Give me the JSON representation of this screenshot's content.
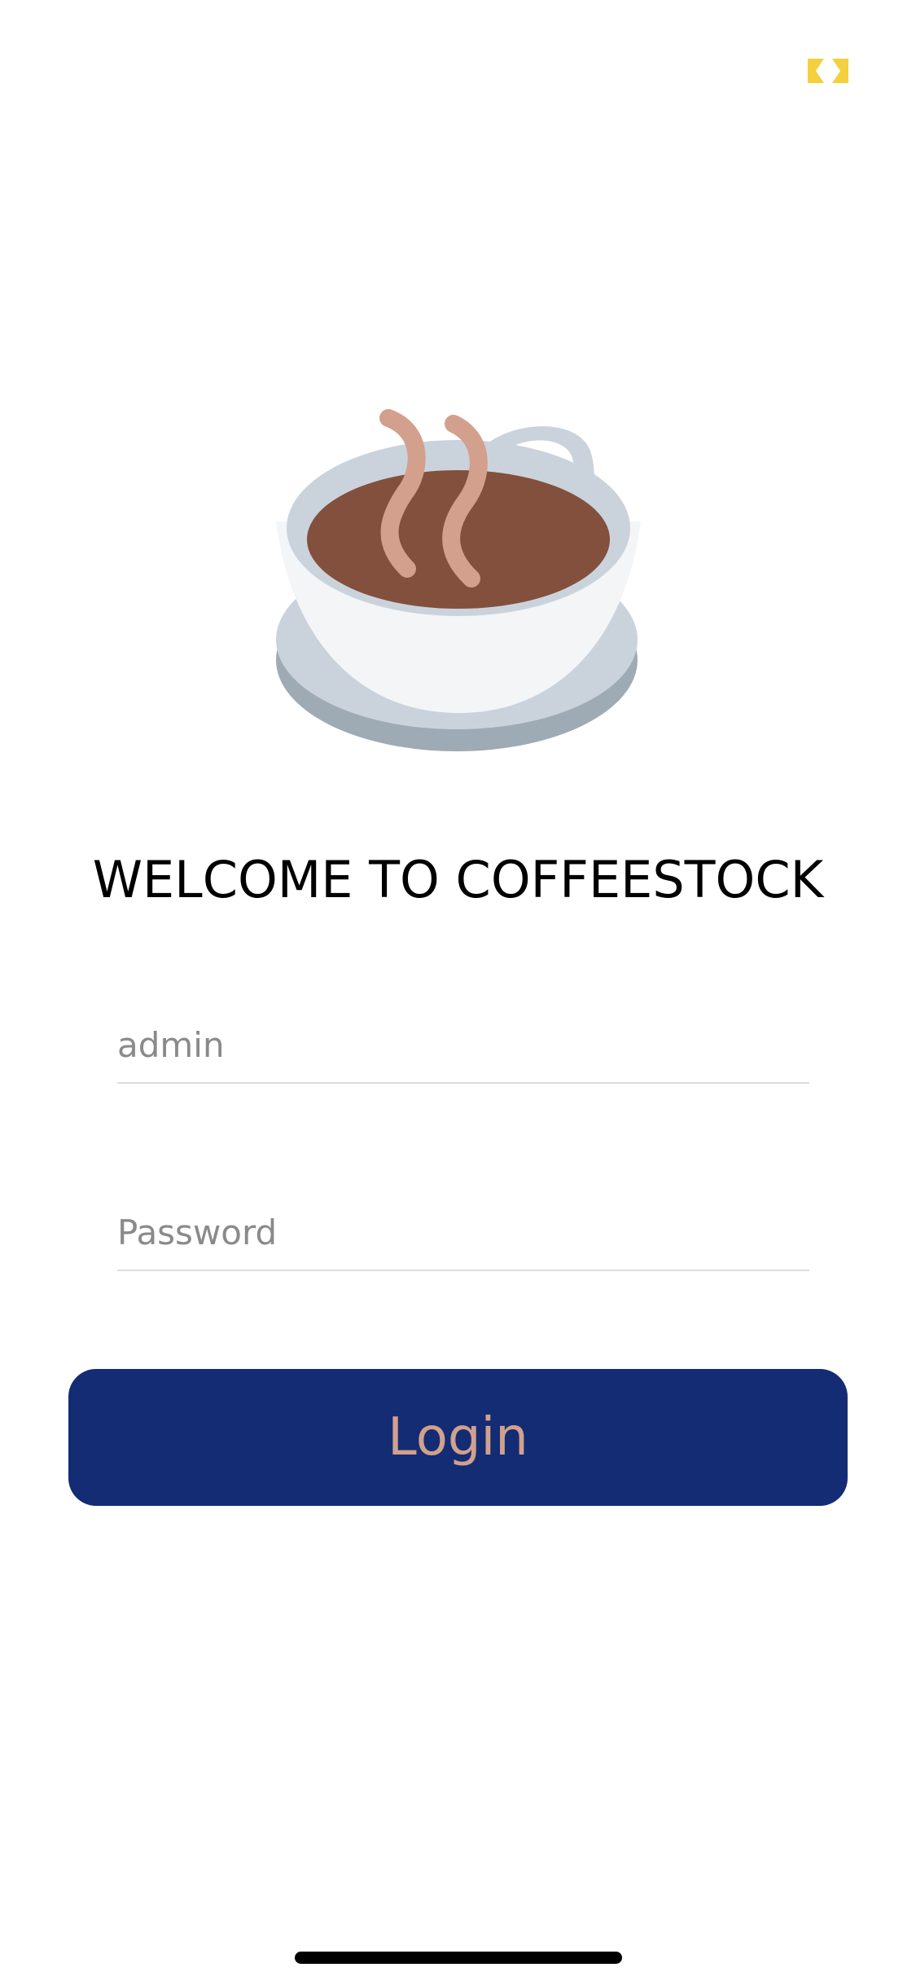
{
  "welcome": {
    "title": "WELCOME TO COFFEESTOCK"
  },
  "login_form": {
    "username_placeholder": "admin",
    "password_placeholder": "Password",
    "login_label": "Login"
  },
  "icons": {
    "hero": "coffee-cup-icon",
    "expand": "expand-icon"
  },
  "colors": {
    "login_button_bg": "#132c73",
    "login_button_text": "#d2a08d",
    "coffee": "#82503c",
    "steam": "#d2a08d",
    "cup_body": "#f3f5f7",
    "saucer": "#cad3dc",
    "expand_icon": "#f4d03f"
  }
}
